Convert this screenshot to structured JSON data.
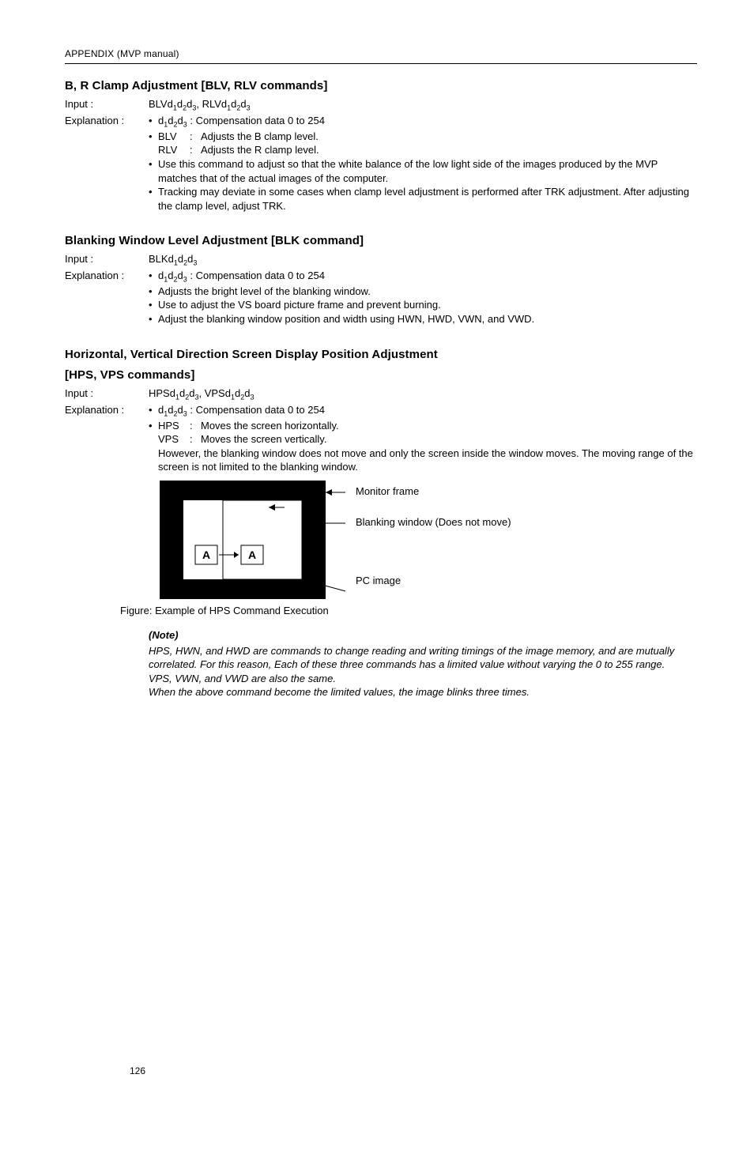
{
  "header": "APPENDIX (MVP manual)",
  "sections": [
    {
      "title": "B, R Clamp Adjustment [BLV, RLV commands]",
      "input_label": "Input :",
      "input_value": "BLVd1d2d3, RLVd1d2d3",
      "expl_label": "Explanation :",
      "bullets": [
        {
          "lead": "d1d2d3",
          "colon": ":",
          "text": "Compensation data 0 to 254",
          "subdefs": [
            {
              "k": "BLV",
              "v": "Adjusts the B clamp level."
            },
            {
              "k": "RLV",
              "v": "Adjusts the R clamp level."
            }
          ]
        },
        {
          "text": "Use this command to adjust so that the white balance of the low light side of the images produced by the MVP matches that of the actual images of the computer."
        },
        {
          "text": "Tracking may deviate in some cases when clamp level adjustment is performed after TRK adjustment. After adjusting the clamp level, adjust TRK."
        }
      ]
    },
    {
      "title": "Blanking Window Level Adjustment [BLK command]",
      "input_label": "Input :",
      "input_value": "BLKd1d2d3",
      "expl_label": "Explanation :",
      "bullets": [
        {
          "lead": "d1d2d3",
          "colon": ":",
          "text": "Compensation data 0 to 254"
        },
        {
          "text": "Adjusts the bright level of the blanking window."
        },
        {
          "text": "Use to adjust the VS board picture frame and prevent burning."
        },
        {
          "text": "Adjust the blanking window position and width using HWN, HWD, VWN, and VWD."
        }
      ]
    },
    {
      "title_line1": "Horizontal, Vertical Direction Screen Display Position Adjustment",
      "title_line2": "[HPS, VPS commands]",
      "input_label": "Input :",
      "input_value": "HPSd1d2d3, VPSd1d2d3",
      "expl_label": "Explanation :",
      "bullets": [
        {
          "lead": "d1d2d3",
          "colon": ":",
          "text": "Compensation data 0 to 254",
          "subdefs": [
            {
              "k": "HPS",
              "v": "Moves the screen horizontally."
            },
            {
              "k": "VPS",
              "v": "Moves the screen vertically."
            }
          ],
          "trailing": "However, the blanking window does not move and only the screen inside the window moves. The moving range of the screen is not limited to the blanking window."
        }
      ]
    }
  ],
  "figure": {
    "label_monitor": "Monitor frame",
    "label_window": "Blanking window (Does not move)",
    "label_pc": "PC image",
    "box_a": "A",
    "caption": "Figure: Example of HPS Command Execution"
  },
  "note": {
    "heading": "(Note)",
    "p1": "HPS, HWN, and HWD are commands to change reading and writing timings of the image memory, and are mutually correlated. For this reason, Each of these three commands has a limited value without varying the 0 to 255 range.",
    "p2": "VPS, VWN, and VWD are also the same.",
    "p3": "When the above command become the limited values, the image blinks three times."
  },
  "page_number": "126"
}
